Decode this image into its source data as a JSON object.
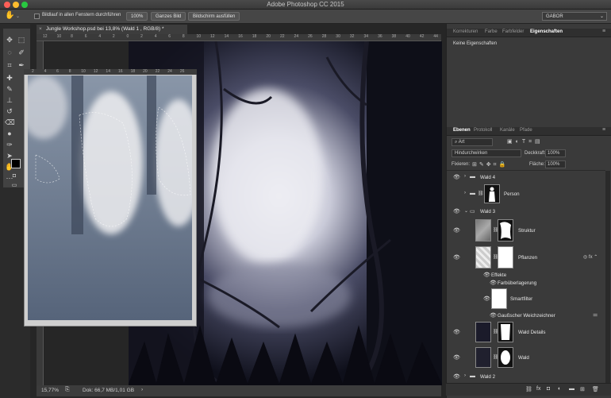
{
  "app": {
    "title": "Adobe Photoshop CC 2015",
    "workspace": "GABOR"
  },
  "options": {
    "checkbox_label": "Bildlauf in allen Fenstern durchführen",
    "zoom_btn": "100%",
    "fit_btn": "Ganzes Bild",
    "fill_btn": "Bildschirm ausfüllen"
  },
  "document": {
    "tab_title": "Jungle Workshop.psd bei 13,8% (Wald 1 , RGB/8) *",
    "ruler_top_ticks": [
      "12",
      "10",
      "8",
      "6",
      "4",
      "2",
      "0",
      "2",
      "4",
      "6",
      "8",
      "10",
      "12",
      "14",
      "16",
      "18",
      "20",
      "22",
      "24",
      "26",
      "28",
      "30",
      "32",
      "34",
      "36",
      "38",
      "40",
      "42",
      "44"
    ],
    "nav_ruler_ticks": [
      "2",
      "4",
      "6",
      "8",
      "10",
      "12",
      "14",
      "16",
      "18",
      "20",
      "22",
      "24",
      "26"
    ],
    "zoom_status": "15,77%",
    "doc_status": "Dok: 66,7 MB/1,01 GB"
  },
  "properties": {
    "tabs": [
      "Korrekturen",
      "Farbe",
      "Farbfelder",
      "Eigenschaften"
    ],
    "active_tab": "Eigenschaften",
    "empty_text": "Keine Eigenschaften"
  },
  "layers_panel": {
    "tabs": [
      "Ebenen",
      "Protokoll",
      "Kanäle",
      "Pfade"
    ],
    "active_tab": "Ebenen",
    "filter_kind": "Art",
    "blend_mode": "Hindurchwirken",
    "opacity_label": "Deckkraft:",
    "opacity": "100%",
    "lock_label": "Fixieren:",
    "fill_label": "Fläche:",
    "fill": "100%",
    "layers": [
      {
        "name": "Wald 4",
        "type": "group"
      },
      {
        "name": "Person",
        "type": "group-masked"
      },
      {
        "name": "Wald 3",
        "type": "group-open"
      },
      {
        "name": "Struktur",
        "type": "layer"
      },
      {
        "name": "Pflanzen",
        "type": "layer-fx"
      },
      {
        "name": "Effekte",
        "type": "fx-header"
      },
      {
        "name": "Farbüberlagerung",
        "type": "fx"
      },
      {
        "name": "Smartfilter",
        "type": "smartfilter"
      },
      {
        "name": "Gaußscher Weichzeichner",
        "type": "filter"
      },
      {
        "name": "Wald Details",
        "type": "layer"
      },
      {
        "name": "Wald",
        "type": "layer"
      },
      {
        "name": "Wald 2",
        "type": "group"
      }
    ]
  },
  "colors": {
    "accent": "#3d6fd6",
    "panel": "#3a3a3a",
    "canvas_bg": "#0c0c14"
  }
}
